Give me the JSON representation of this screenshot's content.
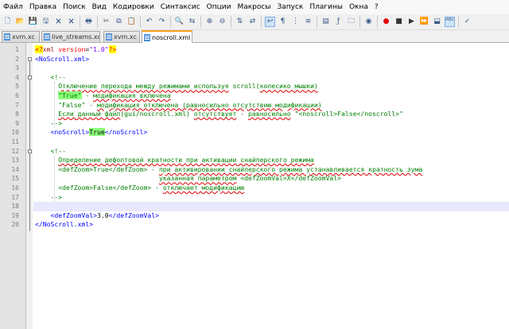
{
  "menu": [
    "Файл",
    "Правка",
    "Поиск",
    "Вид",
    "Кодировки",
    "Синтаксис",
    "Опции",
    "Макросы",
    "Запуск",
    "Плагины",
    "Окна",
    "?"
  ],
  "tabs": [
    {
      "label": "xvm.xc",
      "active": false
    },
    {
      "label": "live_streams.xc",
      "active": false
    },
    {
      "label": "xvm.xc",
      "active": false
    },
    {
      "label": "noscroll.xml",
      "active": true
    }
  ],
  "toolbar_icons": [
    "new-file-icon",
    "open-file-icon",
    "save-icon",
    "save-all-icon",
    "close-icon",
    "close-all-icon",
    "print-icon",
    "cut-icon",
    "copy-icon",
    "paste-icon",
    "undo-icon",
    "redo-icon",
    "find-icon",
    "replace-icon",
    "zoom-in-icon",
    "zoom-out-icon",
    "sync-v-icon",
    "sync-h-icon",
    "wrap-icon",
    "show-all-icon",
    "indent-guide-icon",
    "language-icon",
    "map-icon",
    "function-list-icon",
    "folder-icon",
    "monitor-icon",
    "record-icon",
    "stop-icon",
    "play-icon",
    "play-multi-icon",
    "save-macro-icon",
    "spellcheck-icon",
    "spellcheck-settings-icon"
  ],
  "lines": [
    {
      "n": "1",
      "text": "<?xml version=\"1.0\"?>"
    },
    {
      "n": "2",
      "text": "<NoScroll.xml>"
    },
    {
      "n": "3",
      "text": ""
    },
    {
      "n": "4",
      "text": "    <!--"
    },
    {
      "n": "5",
      "text": "      Отключение перехода между режимами используя scroll(колесико мышки)"
    },
    {
      "n": "6",
      "text": "      \"True\" - модификация включена"
    },
    {
      "n": "7",
      "text": "      \"False\" - модификация отключена (равносильно отсутствию модификации)"
    },
    {
      "n": "8",
      "text": "      Если данный файл(gui/noscroll.xml) отсутствует - равносильно \"<noscroll>False</noscroll>\""
    },
    {
      "n": "9",
      "text": "    -->"
    },
    {
      "n": "10",
      "text": "    <noScroll>True</noScroll>"
    },
    {
      "n": "11",
      "text": ""
    },
    {
      "n": "12",
      "text": "    <!--"
    },
    {
      "n": "13",
      "text": "      Определение дефолтовой кратности при активации снайперского режима"
    },
    {
      "n": "14",
      "text": "      <defZoom>True</defZoom> - при активировании снайперского режима устанавливается кратность зума"
    },
    {
      "n": "15",
      "text": "                                указанная параметром <defZoomVal>X</defZoomVal>"
    },
    {
      "n": "16",
      "text": "      <defZoom>False</defZoom> - отключает модификацию"
    },
    {
      "n": "17",
      "text": "    -->"
    },
    {
      "n": "18",
      "text": "    <defZoom>True</defZoom>"
    },
    {
      "n": "19",
      "text": "    <defZoomVal>3.0</defZoomVal>"
    },
    {
      "n": "20",
      "text": "</NoScroll.xml>"
    }
  ],
  "current_line": "18",
  "colors": {
    "tag": "#0000ff",
    "comment": "#008000",
    "attr": "#ff0000",
    "value": "#8000ff",
    "match": "#8cff7b",
    "current_line": "#e8e8ff",
    "active_tab": "#f7a11a"
  }
}
